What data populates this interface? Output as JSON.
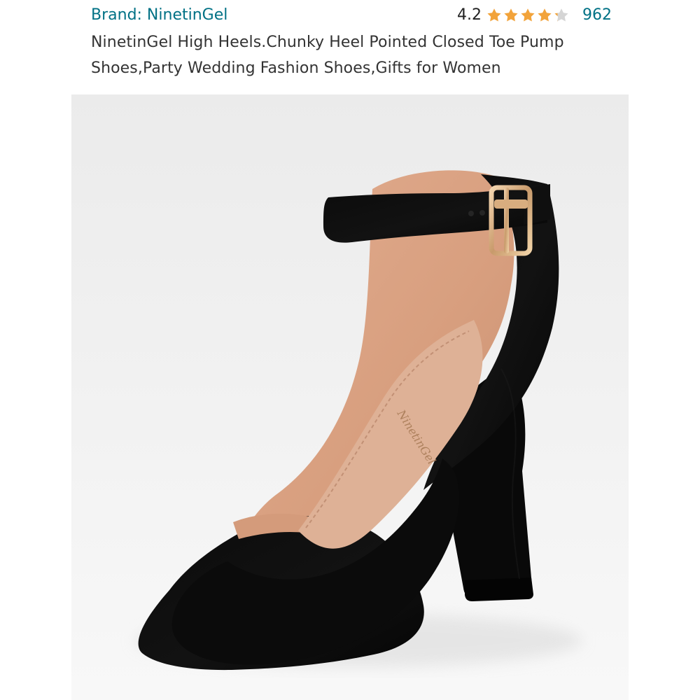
{
  "product": {
    "brand_label": "Brand: NinetinGel",
    "title": "NinetinGel High Heels.Chunky Heel Pointed Closed Toe Pump Shoes,Party Wedding Fashion Shoes,Gifts for Women",
    "rating_value": "4.2",
    "rating_stars": 4.2,
    "rating_max": 5,
    "review_count": "962"
  },
  "colors": {
    "link": "#007185",
    "star_filled": "#f2a33a",
    "star_empty": "#d5d5d5",
    "text": "#333333"
  },
  "image": {
    "subject": "black suede pointed-toe block heel with ankle strap",
    "insole_brand_logo_text": "NinetinGel"
  },
  "icons": {
    "star_filled": "star-icon",
    "star_empty": "star-empty-icon"
  }
}
